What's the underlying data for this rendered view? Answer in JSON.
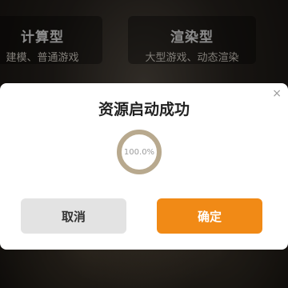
{
  "background": {
    "left_card": {
      "title": "计算型",
      "desc": "建模、普通游戏"
    },
    "right_card": {
      "title": "渲染型",
      "desc": "大型游戏、动态渲染"
    }
  },
  "dialog": {
    "title": "资源启动成功",
    "close_icon": "close-icon",
    "progress": {
      "label": "100.0%",
      "value": 1.0,
      "ring_color": "#b8a98e"
    },
    "cancel_label": "取消",
    "confirm_label": "确定",
    "confirm_color": "#f18a16",
    "cancel_color": "#e3e3e3"
  }
}
